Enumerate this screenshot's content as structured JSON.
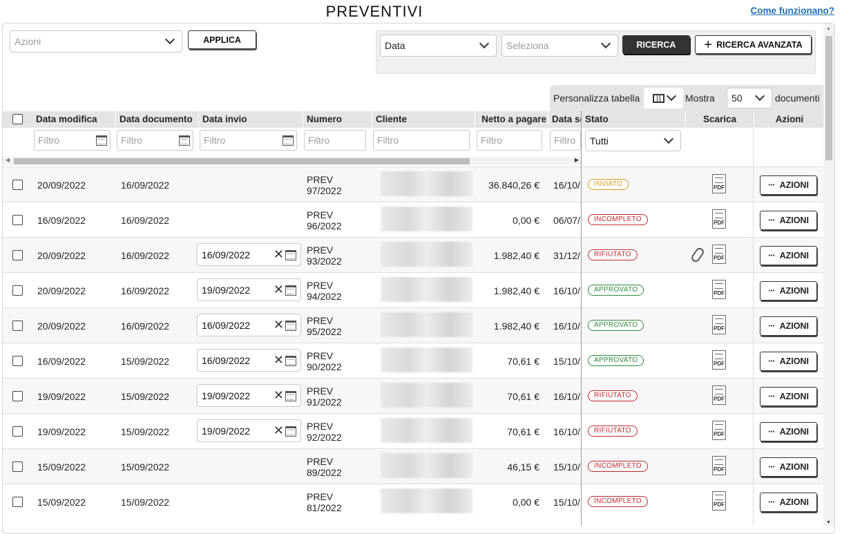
{
  "page": {
    "title": "PREVENTIVI",
    "help_link": "Come funzionano?"
  },
  "toolbar": {
    "actions_placeholder": "Azioni",
    "apply_label": "APPLICA",
    "search_field_value": "Data",
    "search_select_placeholder": "Seleziona",
    "search_label": "RICERCA",
    "advanced_label": "RICERCA AVANZATA"
  },
  "customize": {
    "label": "Personalizza tabella",
    "show_label": "Mostra",
    "page_size": "50",
    "docs_label": "documenti"
  },
  "columns": {
    "data_modifica": "Data modifica",
    "data_documento": "Data documento",
    "data_invio": "Data invio",
    "numero": "Numero",
    "cliente": "Cliente",
    "netto": "Netto a pagare",
    "data_scadenza": "Data scadenza",
    "stato": "Stato",
    "scarica": "Scarica",
    "azioni": "Azioni"
  },
  "filters": {
    "placeholder": "Filtro",
    "stato_value": "Tutti"
  },
  "actions_button_label": "AZIONI",
  "pdf_label": "PDF",
  "status_colors": {
    "INVIATO": "#d99a1b",
    "INCOMPLETO": "#c0282d",
    "RIFIUTATO": "#c0282d",
    "APPROVATO": "#2e8b3a"
  },
  "rows": [
    {
      "data_modifica": "20/09/2022",
      "data_documento": "16/09/2022",
      "data_invio": "",
      "numero": "PREV\n97/2022",
      "netto": "36.840,26 €",
      "data_scadenza": "16/10/",
      "stato": "INVIATO",
      "attachment": false
    },
    {
      "data_modifica": "16/09/2022",
      "data_documento": "16/09/2022",
      "data_invio": "",
      "numero": "PREV\n96/2022",
      "netto": "0,00 €",
      "data_scadenza": "06/07/",
      "stato": "INCOMPLETO",
      "attachment": false
    },
    {
      "data_modifica": "20/09/2022",
      "data_documento": "16/09/2022",
      "data_invio": "16/09/2022",
      "numero": "PREV\n93/2022",
      "netto": "1.982,40 €",
      "data_scadenza": "31/12/",
      "stato": "RIFIUTATO",
      "attachment": true
    },
    {
      "data_modifica": "20/09/2022",
      "data_documento": "16/09/2022",
      "data_invio": "19/09/2022",
      "numero": "PREV\n94/2022",
      "netto": "1.982,40 €",
      "data_scadenza": "16/10/",
      "stato": "APPROVATO",
      "attachment": false
    },
    {
      "data_modifica": "20/09/2022",
      "data_documento": "16/09/2022",
      "data_invio": "16/09/2022",
      "numero": "PREV\n95/2022",
      "netto": "1.982,40 €",
      "data_scadenza": "16/10/",
      "stato": "APPROVATO",
      "attachment": false
    },
    {
      "data_modifica": "16/09/2022",
      "data_documento": "15/09/2022",
      "data_invio": "16/09/2022",
      "numero": "PREV\n90/2022",
      "netto": "70,61 €",
      "data_scadenza": "15/10/",
      "stato": "APPROVATO",
      "attachment": false
    },
    {
      "data_modifica": "19/09/2022",
      "data_documento": "15/09/2022",
      "data_invio": "19/09/2022",
      "numero": "PREV\n91/2022",
      "netto": "70,61 €",
      "data_scadenza": "16/10/",
      "stato": "RIFIUTATO",
      "attachment": false
    },
    {
      "data_modifica": "19/09/2022",
      "data_documento": "15/09/2022",
      "data_invio": "19/09/2022",
      "numero": "PREV\n92/2022",
      "netto": "70,61 €",
      "data_scadenza": "16/10/",
      "stato": "RIFIUTATO",
      "attachment": false
    },
    {
      "data_modifica": "15/09/2022",
      "data_documento": "15/09/2022",
      "data_invio": "",
      "numero": "PREV\n89/2022",
      "netto": "46,15 €",
      "data_scadenza": "15/10/",
      "stato": "INCOMPLETO",
      "attachment": false
    },
    {
      "data_modifica": "15/09/2022",
      "data_documento": "15/09/2022",
      "data_invio": "",
      "numero": "PREV\n81/2022",
      "netto": "0,00 €",
      "data_scadenza": "15/10/",
      "stato": "INCOMPLETO",
      "attachment": false
    }
  ]
}
